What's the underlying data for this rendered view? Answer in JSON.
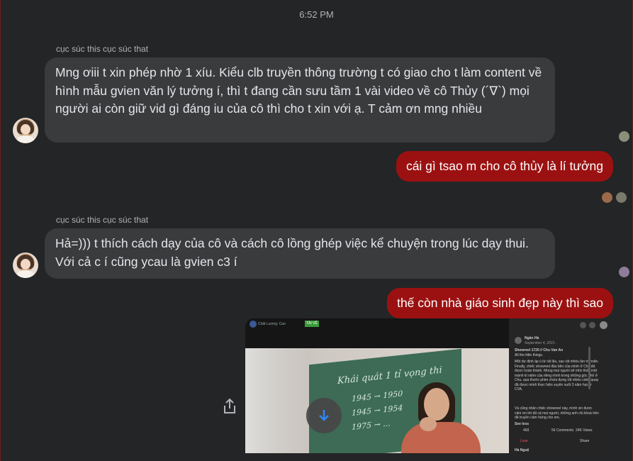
{
  "timestamp": "6:52 PM",
  "messages": [
    {
      "sender": "cục súc this cục súc that",
      "text": "Mng ơiii t xin phép nhờ 1 xíu. Kiểu clb truyền thông trường t có giao cho t làm content về hình mẫu gvien văn lý tưởng í, thì t đang cần sưu tầm 1 vài video về cô Thủy (´∇`) mọi người ai còn giữ vid gì đáng iu của cô thì cho t xin với ạ. T cảm ơn mng nhiều"
    },
    {
      "text": "cái gì tsao m cho cô thủy là lí tưởng"
    },
    {
      "sender": "cục súc this cục súc that",
      "text": "Hả=))) t thích cách dạy của cô và cách cô lồng ghép việc kể chuyện trong lúc dạy thui. Với cả c í cũng ycau là gvien c3 í"
    },
    {
      "text": "thế còn nhà giáo sinh đẹp này thì sao"
    }
  ],
  "media": {
    "player_quality_label": "Chất Lượng: Cao",
    "player_tag": "TẢI VỀ",
    "post_author": "Ngân Hà",
    "post_date": "September 4, 2021 · ",
    "post_title": "Showreel 1720 // Chu Van An",
    "post_subtitle": "All the little things.",
    "post_body": "Một dự định ấp ủ từ rất lâu, sau rất nhiều lần trì hoãn. Finally, chiếc showreel đầu tiên của mình ở Chu đã được hoàn thành. Mong mọi người sẽ nhìn thấy một mảnh kí niệm của riêng mình trong những góc nhỏ ở Chu, qua thước phim chứa đựng rất nhiều cảnh quay đã được mình thực hiện xuyên suốt 3 năm học ở CVA.",
    "post_body2": "Và cũng nhân chiếc showreel này, mình xin được cảm ơn tới tất cả mọi người, những anh chị khoá trên đã truyền cảm hứng cho em,",
    "see_less": "See less",
    "reactions": "469",
    "comments": "56 Comments",
    "views": "24K Views",
    "love_label": "Love",
    "share_label": "Share",
    "next_author": "Hà Nguệ",
    "chalk_lines": [
      "Khái quát 1 tỉ vọng thi",
      "1945 → 1950",
      "1945 → 1954",
      "1975 → ..."
    ]
  },
  "icons": {
    "download": "download-icon",
    "share": "share-icon"
  },
  "colors": {
    "background": "#242526",
    "incoming_bubble": "#3a3b3c",
    "outgoing_bubble": "#9b1111",
    "accent": "#2d88ff"
  }
}
